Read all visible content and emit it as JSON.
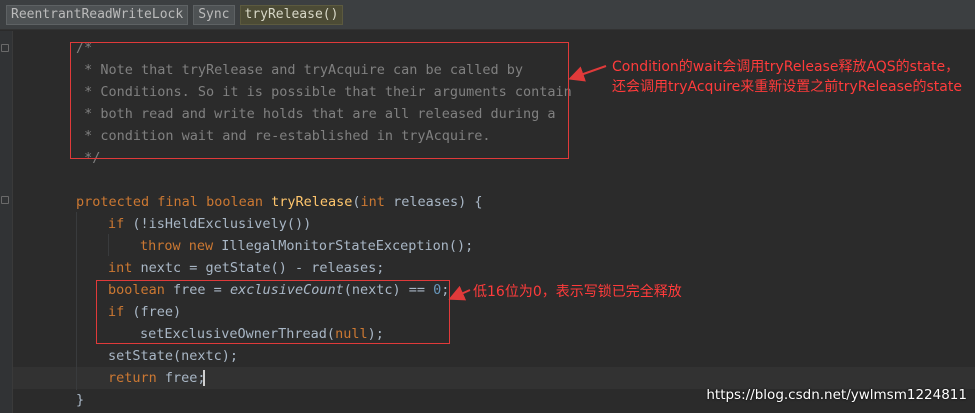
{
  "breadcrumb": {
    "items": [
      {
        "label": "ReentrantReadWriteLock"
      },
      {
        "label": "Sync"
      },
      {
        "label": "tryRelease()"
      }
    ]
  },
  "code": {
    "comment_lines": [
      "/*",
      " * Note that tryRelease and tryAcquire can be called by",
      " * Conditions. So it is possible that their arguments contain",
      " * both read and write holds that are all released during a",
      " * condition wait and re-established in tryAcquire.",
      " */"
    ],
    "sig_protected": "protected",
    "sig_final": "final",
    "sig_boolean": "boolean",
    "sig_name": "tryRelease",
    "sig_paren_open": "(",
    "sig_int": "int",
    "sig_rest": " releases) {",
    "if1_kw": "if",
    "if1_rest": " (!isHeldExclusively())",
    "throw_kw": "throw",
    "new_kw": "new",
    "throw_rest": " IllegalMonitorStateException();",
    "nextc_type": "int",
    "nextc_rest": " nextc = getState() - releases;",
    "free_type": "boolean",
    "free_mid": " free = ",
    "free_call": "exclusiveCount",
    "free_after": "(nextc) == ",
    "free_zero": "0",
    "free_end": ";",
    "if2_kw": "if",
    "if2_rest": " (free)",
    "setowner_pre": "setExclusiveOwnerThread(",
    "null_kw": "null",
    "setowner_post": ");",
    "setstate": "setState(nextc);",
    "return_kw": "return",
    "return_rest": " free;",
    "close_brace": "}"
  },
  "annotations": {
    "note1": "Condition的wait会调用tryRelease释放AQS的state，还会调用tryAcquire来重新设置之前tryRelease的state",
    "note2": "低16位为0，表示写锁已完全释放"
  },
  "watermark": "https://blog.csdn.net/ywlmsm1224811",
  "colors": {
    "background": "#2b2b2b",
    "comment": "#808080",
    "keyword": "#cc7832",
    "method": "#ffc66d",
    "number": "#6897bb",
    "annotation": "#ff3b3b"
  }
}
